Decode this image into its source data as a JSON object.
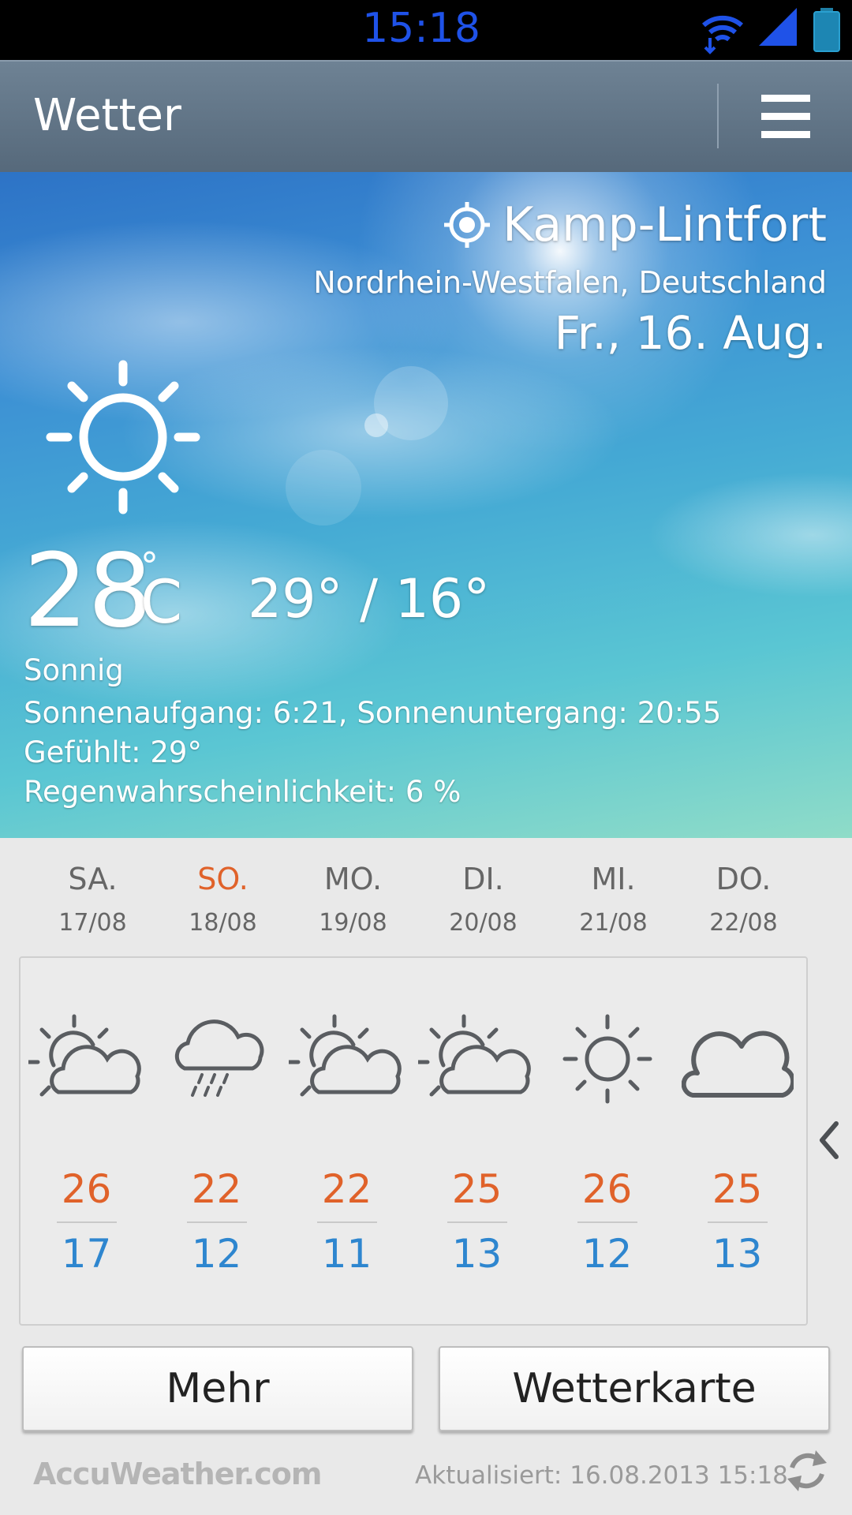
{
  "status_bar": {
    "time": "15:18"
  },
  "app_bar": {
    "title": "Wetter"
  },
  "current": {
    "location": "Kamp-Lintfort",
    "region": "Nordrhein-Westfalen, Deutschland",
    "date": "Fr., 16. Aug.",
    "temperature": "28",
    "unit": "C",
    "degree": "°",
    "high_low": "29° / 16°",
    "condition": "Sonnig",
    "sun_times": "Sonnenaufgang: 6:21, Sonnenuntergang: 20:55",
    "feels_like": "Gefühlt: 29°",
    "rain_chance": "Regenwahrscheinlichkeit: 6 %",
    "icon": "sun-icon"
  },
  "forecast": [
    {
      "day": "SA.",
      "date": "17/08",
      "high": "26",
      "low": "17",
      "icon": "partly-cloudy-icon",
      "day_color": "#666666"
    },
    {
      "day": "SO.",
      "date": "18/08",
      "high": "22",
      "low": "12",
      "icon": "rain-icon",
      "day_color": "#e0622a"
    },
    {
      "day": "MO.",
      "date": "19/08",
      "high": "22",
      "low": "11",
      "icon": "partly-cloudy-icon",
      "day_color": "#666666"
    },
    {
      "day": "DI.",
      "date": "20/08",
      "high": "25",
      "low": "13",
      "icon": "partly-cloudy-icon",
      "day_color": "#666666"
    },
    {
      "day": "MI.",
      "date": "21/08",
      "high": "26",
      "low": "12",
      "icon": "sun-icon",
      "day_color": "#666666"
    },
    {
      "day": "DO.",
      "date": "22/08",
      "high": "25",
      "low": "13",
      "icon": "cloud-icon",
      "day_color": "#666666"
    }
  ],
  "buttons": {
    "more": "Mehr",
    "weather_map": "Wetterkarte"
  },
  "footer": {
    "logo": "AccuWeather.com",
    "updated": "Aktualisiert: 16.08.2013 15:18"
  },
  "colors": {
    "high": "#e0622a",
    "low": "#2e86cf",
    "sunday": "#e0622a",
    "status_time": "#1f52e8"
  }
}
